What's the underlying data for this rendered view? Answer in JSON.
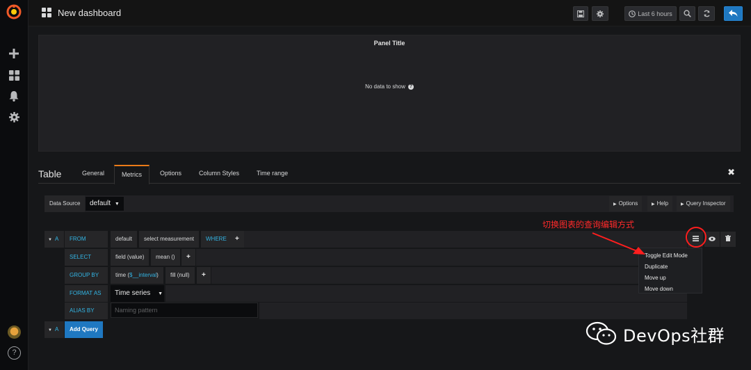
{
  "navbar": {
    "dashboard_title": "New dashboard",
    "time_range_label": "Last 6 hours"
  },
  "panel": {
    "title": "Panel Title",
    "empty_message": "No data to show"
  },
  "editor": {
    "panel_type": "Table",
    "tabs": [
      {
        "label": "General",
        "active": false
      },
      {
        "label": "Metrics",
        "active": true
      },
      {
        "label": "Options",
        "active": false
      },
      {
        "label": "Column Styles",
        "active": false
      },
      {
        "label": "Time range",
        "active": false
      }
    ]
  },
  "datasource": {
    "label": "Data Source",
    "value": "default",
    "buttons": [
      "Options",
      "Help",
      "Query Inspector"
    ]
  },
  "query": {
    "ref_id": "A",
    "from": {
      "keyword": "FROM",
      "policy": "default",
      "measurement": "select measurement",
      "where": "WHERE"
    },
    "select": {
      "keyword": "SELECT",
      "field": "field (value)",
      "func": "mean ()"
    },
    "group_by": {
      "keyword": "GROUP BY",
      "time_prefix": "time (",
      "time_interval": "$__interval",
      "time_suffix": ")",
      "fill": "fill (null)"
    },
    "format_as": {
      "keyword": "FORMAT AS",
      "value": "Time series"
    },
    "alias_by": {
      "keyword": "ALIAS BY",
      "placeholder": "Naming pattern"
    },
    "add_query_label": "Add Query",
    "second_ref_id": "A"
  },
  "menu": {
    "items": [
      "Toggle Edit Mode",
      "Duplicate",
      "Move up",
      "Move down"
    ]
  },
  "annotation": {
    "text": "切换图表的查询编辑方式"
  },
  "watermark": {
    "text": "DevOps社群"
  },
  "colors": {
    "accent": "#eb7b18",
    "keyword": "#33b5e5",
    "primary": "#1f78c1",
    "annotation": "#ff2a2a"
  }
}
